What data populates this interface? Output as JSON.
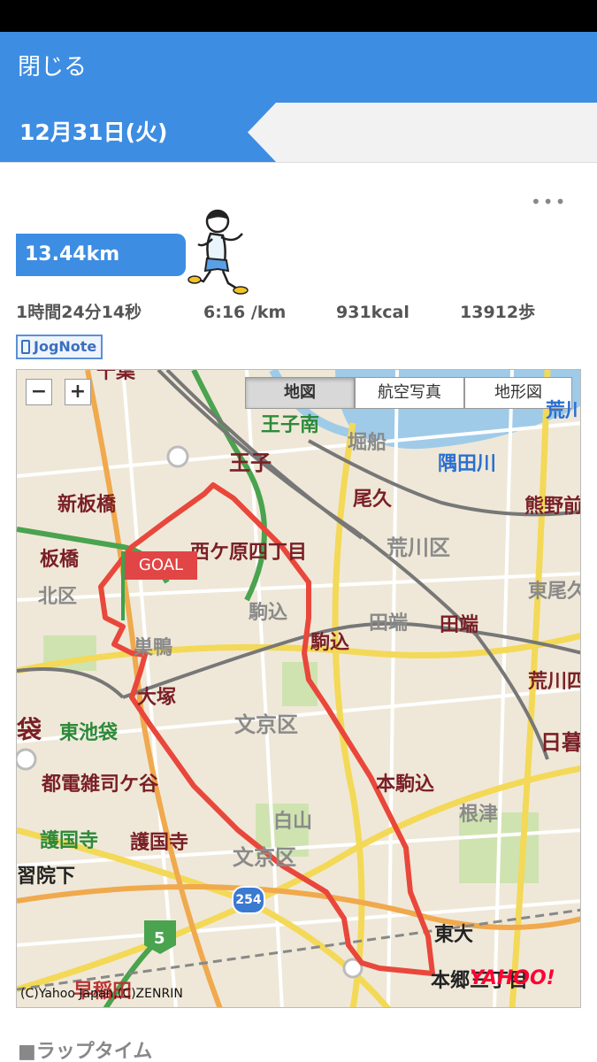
{
  "header": {
    "close_label": "閉じる"
  },
  "date": {
    "label": "12月31日(火)"
  },
  "more_label": "•••",
  "summary": {
    "distance": "13.44km",
    "duration": "1時間24分14秒",
    "pace": "6:16 /km",
    "calories": "931kcal",
    "steps": "13912歩"
  },
  "source_badge": "JogNote",
  "map": {
    "zoom_out_label": "−",
    "zoom_in_label": "+",
    "types": [
      {
        "label": "地図",
        "active": true
      },
      {
        "label": "航空写真",
        "active": false
      },
      {
        "label": "地形図",
        "active": false
      }
    ],
    "goal_label": "GOAL",
    "route_shield": "254",
    "expressway_shield": "5",
    "labels": {
      "senju": "千葉",
      "oji": "王子",
      "oji_minami": "王子南",
      "horifune": "堀船",
      "sumidagawa": "隅田川",
      "arakawa": "荒川",
      "shin_itabashi": "新板橋",
      "itabashi": "板橋",
      "kitaku": "北区",
      "nishigahara": "西ケ原四丁目",
      "ogu": "尾久",
      "arakawaku": "荒川区",
      "kumano": "熊野前",
      "higashi_ogu": "東尾久",
      "komagome_gray": "駒込",
      "komagome": "駒込",
      "tabata_gray": "田端",
      "tabata": "田端",
      "arakawa_right": "荒川四",
      "sugamo": "巣鴨",
      "otsuka": "大塚",
      "bunkyo": "文京区",
      "higashi_ikebukuro": "東池袋",
      "bukuro": "袋",
      "nippori": "日暮",
      "toden_zoshigaya": "都電雑司ケ谷",
      "honkomagome": "本駒込",
      "nezu": "根津",
      "hakusan": "白山",
      "gokokuji_green": "護国寺",
      "gokokuji": "護国寺",
      "gakushuin": "習院下",
      "bunkyo2": "文京区",
      "todai": "東大",
      "hongo": "本郷三丁目",
      "waseda": "早稲田"
    },
    "copyright": "(C)Yahoo Japan,(C)ZENRIN",
    "provider_logo": "YAHOO!"
  },
  "lap_heading": "■ラップタイム",
  "colors": {
    "accent": "#3d8de3",
    "route": "#e9473b",
    "goal_pole": "#3aa34a"
  }
}
